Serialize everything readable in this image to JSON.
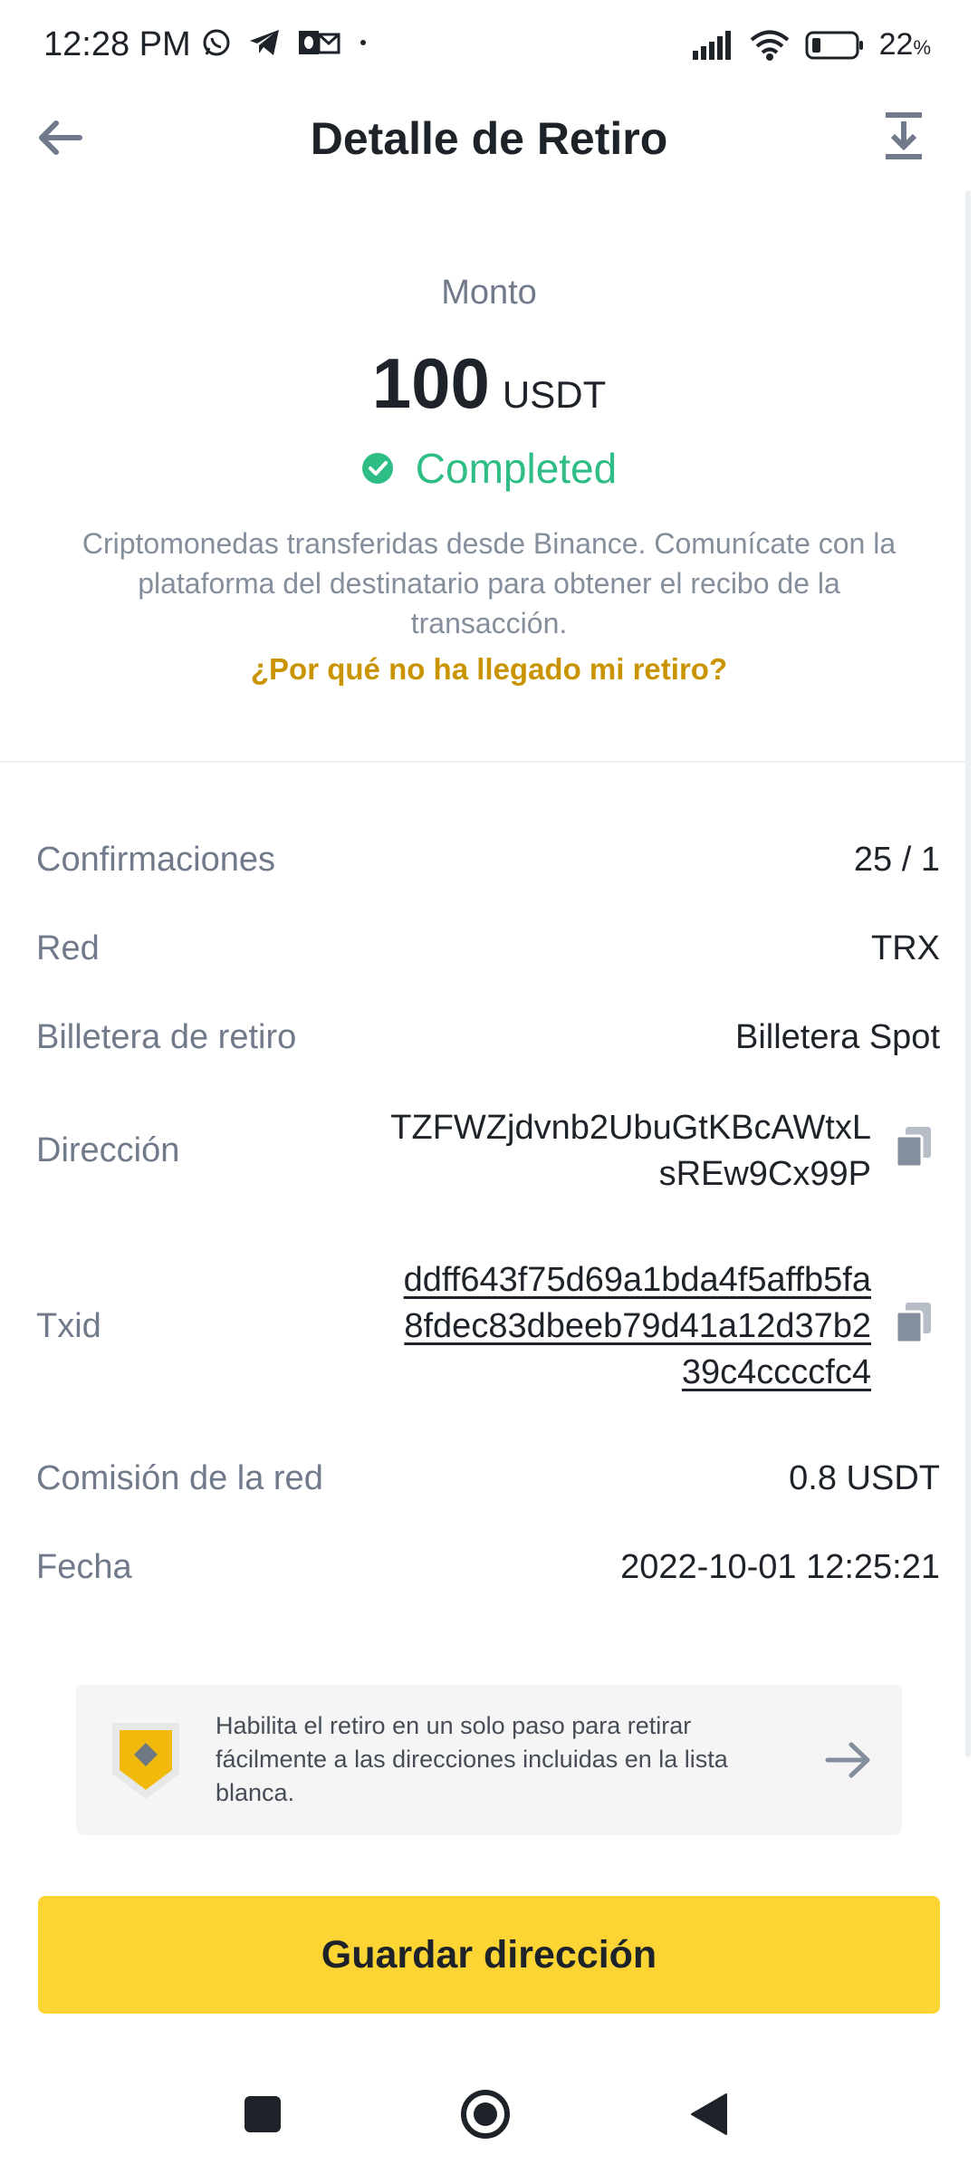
{
  "status_bar": {
    "time": "12:28 PM",
    "battery": "22",
    "battery_unit": "%"
  },
  "header": {
    "title": "Detalle de Retiro",
    "back_icon": "arrow-left-icon",
    "download_icon": "download-icon"
  },
  "amount": {
    "label": "Monto",
    "value": "100",
    "currency": "USDT",
    "status": "Completed",
    "status_color": "#2ebd85",
    "description": "Criptomonedas transferidas desde Binance. Comunícate con la plataforma del destinatario para obtener el recibo de la transacción.",
    "why_link": "¿Por qué no ha llegado mi retiro?"
  },
  "details": {
    "confirmations": {
      "label": "Confirmaciones",
      "value": "25 / 1"
    },
    "network": {
      "label": "Red",
      "value": "TRX"
    },
    "wallet": {
      "label": "Billetera de retiro",
      "value": "Billetera Spot"
    },
    "address": {
      "label": "Dirección",
      "line1": "TZFWZjdvnb2UbuGtKBcAWtxL",
      "line2": "sREw9Cx99P"
    },
    "txid": {
      "label": "Txid",
      "line1": "ddff643f75d69a1bda4f5affb5fa",
      "line2": "8fdec83dbeeb79d41a12d37b2",
      "line3": "39c4ccccfc4"
    },
    "fee": {
      "label": "Comisión de la red",
      "value": "0.8 USDT"
    },
    "date": {
      "label": "Fecha",
      "value": "2022-10-01 12:25:21"
    }
  },
  "promo": {
    "text": "Habilita el retiro en un solo paso para retirar fácilmente a las direcciones incluidas en la lista blanca.",
    "icon": "shield-icon"
  },
  "save_button": {
    "label": "Guardar dirección",
    "color": "#fcd535"
  },
  "colors": {
    "accent": "#fcd535",
    "link": "#c99400",
    "muted": "#707a8a"
  }
}
